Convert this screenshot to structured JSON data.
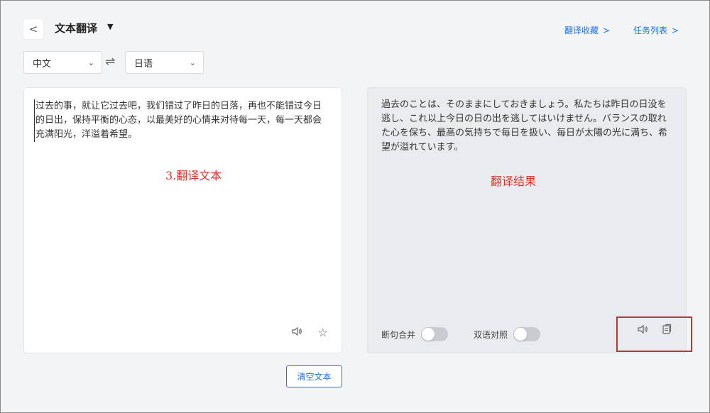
{
  "header": {
    "back_icon": "chevron-left-icon",
    "back_glyph": "<",
    "title": "文本翻译",
    "title_caret": "▼",
    "links": [
      {
        "label": "翻译收藏",
        "chevron": ">"
      },
      {
        "label": "任务列表",
        "chevron": ">"
      }
    ]
  },
  "languages": {
    "source": "中文",
    "target": "日语",
    "dropdown_icon": "chevron-down-icon",
    "swap_icon": "swap-arrows-icon",
    "swap_glyph": "⇌"
  },
  "source_panel": {
    "text": "过去的事，就让它过去吧，我们错过了昨日的日落，再也不能错过今日的日出，保持平衡的心态，以最美好的心情来对待每一天，每一天都会充满阳光，洋溢着希望。",
    "annotation": "3.翻译文本",
    "actions": [
      {
        "icon": "speaker-icon",
        "glyph": "🔈"
      },
      {
        "icon": "star-icon",
        "glyph": "☆"
      }
    ]
  },
  "target_panel": {
    "text": "過去のことは、そのままにしておきましょう。私たちは昨日の日没を逃し、これ以上今日の日の出を逃してはいけません。バランスの取れた心を保ち、最高の気持ちで毎日を扱い、毎日が太陽の光に満ち、希望が溢れています。",
    "annotation": "翻译结果",
    "toggles": [
      {
        "label": "断句合并",
        "on": false
      },
      {
        "label": "双语对照",
        "on": false
      }
    ],
    "actions": [
      {
        "icon": "speaker-icon",
        "glyph": "🔈"
      },
      {
        "icon": "copy-icon",
        "glyph": "⎘"
      }
    ]
  },
  "footer": {
    "clear_label": "清空文本"
  },
  "colors": {
    "accent": "#1a73e8",
    "annotation": "#d9342b",
    "highlight_border": "#b53a2f"
  }
}
